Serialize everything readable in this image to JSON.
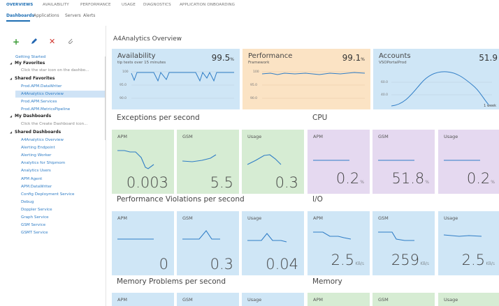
{
  "topnav": [
    "OVERVIEWS",
    "AVAILABILITY",
    "PERFORMANCE",
    "USAGE",
    "DIAGNOSTICS",
    "APPLICATION ONBOARDING"
  ],
  "subnav": [
    "Dashboards",
    "Applications",
    "Servers",
    "Alerts"
  ],
  "sidebar": {
    "getting_started": "Getting Started",
    "my_favorites": "My Favorites",
    "favorites_hint": "Click the star icon on the dashbo...",
    "shared_favorites": "Shared Favorites",
    "shared_favorite_items": [
      "Prod.APM.DataWriter",
      "A4Analytics Overview",
      "Prod.APM.Services",
      "Prod.APM.MetricsPipeline"
    ],
    "my_dashboards": "My Dashboards",
    "dashboards_hint": "Click the Create Dashboard icon...",
    "shared_dashboards": "Shared Dashboards",
    "shared_dashboard_items": [
      "A4Analytics Overview",
      "Alerting Endpoint",
      "Alerting Worker",
      "Analytics for Shipmom",
      "Analytics Users",
      "APM Agent",
      "APM.DataWriter",
      "Config Deployment Service",
      "Debug",
      "Doppler Service",
      "Graph Service",
      "GSM Service",
      "GSMT Service"
    ]
  },
  "page_title": "A4Analytics Overview",
  "header_tiles": {
    "availability": {
      "title": "Availability",
      "subtitle": "tip tests over 15 minutes",
      "value": "99.5",
      "unit": "%",
      "axis": [
        "100",
        "95.0",
        "90.0"
      ]
    },
    "performance": {
      "title": "Performance",
      "subtitle": "Framework",
      "value": "99.1",
      "unit": "%",
      "axis": [
        "100",
        "95.0",
        "90.0"
      ]
    },
    "accounts": {
      "title": "Accounts",
      "subtitle": "VSOPortalProd",
      "value": "51.9",
      "axis": [
        "60.0",
        "40.0"
      ],
      "period": "1 week"
    }
  },
  "sections": {
    "exceptions": "Exceptions per second",
    "cpu": "CPU",
    "violations": "Performance Violations per second",
    "io": "I/O",
    "memory_problems": "Memory Problems per second",
    "memory": "Memory"
  },
  "tiles": {
    "exceptions": [
      {
        "label": "APM",
        "value": "0.003",
        "unit": ""
      },
      {
        "label": "GSM",
        "value": "5.5",
        "unit": ""
      },
      {
        "label": "Usage",
        "value": "0.3",
        "unit": ""
      }
    ],
    "cpu": [
      {
        "label": "APM",
        "value": "0.2",
        "unit": "%"
      },
      {
        "label": "GSM",
        "value": "51.8",
        "unit": "%"
      },
      {
        "label": "Usage",
        "value": "0.2",
        "unit": "%"
      }
    ],
    "violations": [
      {
        "label": "APM",
        "value": "0",
        "unit": ""
      },
      {
        "label": "GSM",
        "value": "0.3",
        "unit": ""
      },
      {
        "label": "Usage",
        "value": "0.04",
        "unit": ""
      }
    ],
    "io": [
      {
        "label": "APM",
        "value": "2.5",
        "unit": "KB/s"
      },
      {
        "label": "GSM",
        "value": "259",
        "unit": "KB/s"
      },
      {
        "label": "Usage",
        "value": "2.5",
        "unit": "KB/s"
      }
    ],
    "memory_problems": [
      {
        "label": "APM"
      },
      {
        "label": "GSM"
      },
      {
        "label": "Usage"
      }
    ],
    "memory": [
      {
        "label": "APM"
      },
      {
        "label": "GSM"
      },
      {
        "label": "Usage"
      }
    ]
  },
  "colors": {
    "accent": "#1c6db3",
    "line": "#2f7dc6",
    "blue_tile": "#cfe6f6",
    "orange_tile": "#fbe3c4",
    "green_tile": "#d6ecd3",
    "purple_tile": "#e5d9f0"
  }
}
